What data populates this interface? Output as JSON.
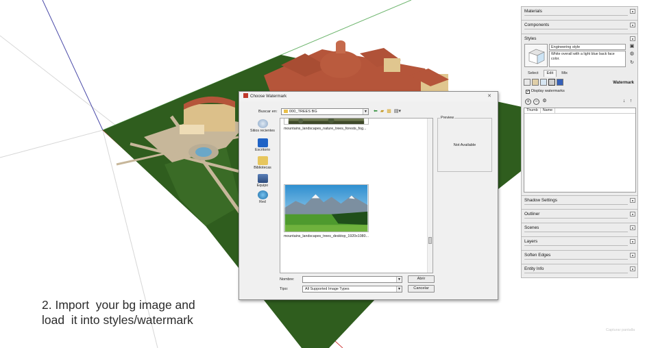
{
  "tray": {
    "materials": "Materials",
    "components": "Components",
    "styles": {
      "title": "Styles",
      "style_name": "Engineering style",
      "style_description": "White overall with a light blue back face color.",
      "tabs": [
        "Select",
        "Edit",
        "Mix"
      ],
      "active_tab": "Edit",
      "panel_label": "Watermark",
      "display_watermarks_label": "Display watermarks",
      "display_watermarks_checked": true,
      "list_columns": [
        "Thumb",
        "Name"
      ]
    },
    "collapsed": [
      "Shadow Settings",
      "Outliner",
      "Scenes",
      "Layers",
      "Soften Edges",
      "Entity Info"
    ]
  },
  "dialog": {
    "title": "Choose Watermark",
    "close_glyph": "✕",
    "look_in_label": "Buscar en:",
    "look_in_value": "000_TREES BG",
    "places": [
      "Sitios recientes",
      "Escritorio",
      "Bibliotecas",
      "Equipo",
      "Red"
    ],
    "files": [
      "mountains_landscapes_nature_trees_forests_fog...",
      "mountains_landscapes_trees_desktop_1920x1080..."
    ],
    "preview_label": "Preview",
    "preview_text": "Not Available",
    "filename_label": "Nombre:",
    "filename_value": "",
    "filetype_label": "Tipo:",
    "filetype_value": "All Supported Image Types",
    "open_button": "Abrir",
    "cancel_button": "Cancelar"
  },
  "caption": "2. Import  your bg image and\nload  it into styles/watermark",
  "corner_text": "Capturar pantalla",
  "colors": {
    "grass": "#2f5d1e",
    "roof": "#b5553a",
    "path": "#c7b79a"
  }
}
